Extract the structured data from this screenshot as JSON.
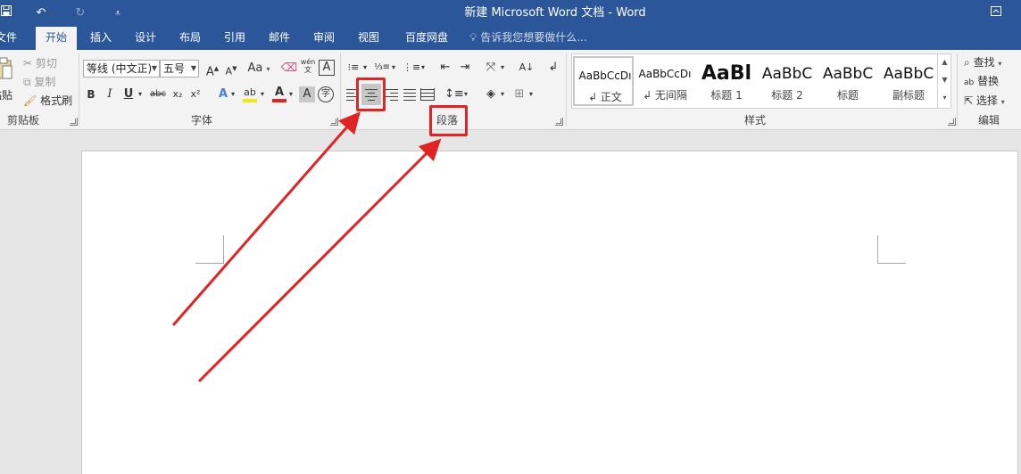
{
  "titlebar": {
    "title": "新建 Microsoft Word 文档 - Word",
    "save_icon": "save-icon",
    "undo_icon": "undo-icon",
    "redo_icon": "redo-icon",
    "customize_icon": "customize-qat-icon",
    "restore_icon": "ribbon-display-icon"
  },
  "tabs": [
    "文件",
    "开始",
    "插入",
    "设计",
    "布局",
    "引用",
    "邮件",
    "审阅",
    "视图",
    "百度网盘"
  ],
  "active_tab": "开始",
  "tell_me": "告诉我您想要做什么...",
  "clipboard": {
    "paste": "粘贴",
    "cut": "剪切",
    "copy": "复制",
    "format_painter": "格式刷",
    "label": "剪贴板"
  },
  "font": {
    "font_name": "等线 (中文正)",
    "font_size": "五号",
    "grow": "A",
    "shrink": "A",
    "case": "Aa",
    "phonetic": "wén",
    "bold": "B",
    "italic": "I",
    "underline": "U",
    "strike": "abc",
    "subscript": "x₂",
    "superscript": "x²",
    "label": "字体"
  },
  "paragraph": {
    "label": "段落"
  },
  "styles": {
    "items": [
      {
        "preview": "AaBbCcDı",
        "name": "↲ 正文"
      },
      {
        "preview": "AaBbCcDı",
        "name": "↲ 无间隔"
      },
      {
        "preview": "AaBl",
        "name": "标题 1"
      },
      {
        "preview": "AaBbC",
        "name": "标题 2"
      },
      {
        "preview": "AaBbC",
        "name": "标题"
      },
      {
        "preview": "AaBbC",
        "name": "副标题"
      }
    ],
    "label": "样式"
  },
  "editing": {
    "find": "查找",
    "replace": "替换",
    "select": "选择",
    "label": "编辑"
  },
  "colors": {
    "titlebar": "#2b579a",
    "ribbon": "#f3f3f3",
    "annotation": "#e02424",
    "highlight_yellow": "#f5e614",
    "font_red": "#e02424"
  }
}
